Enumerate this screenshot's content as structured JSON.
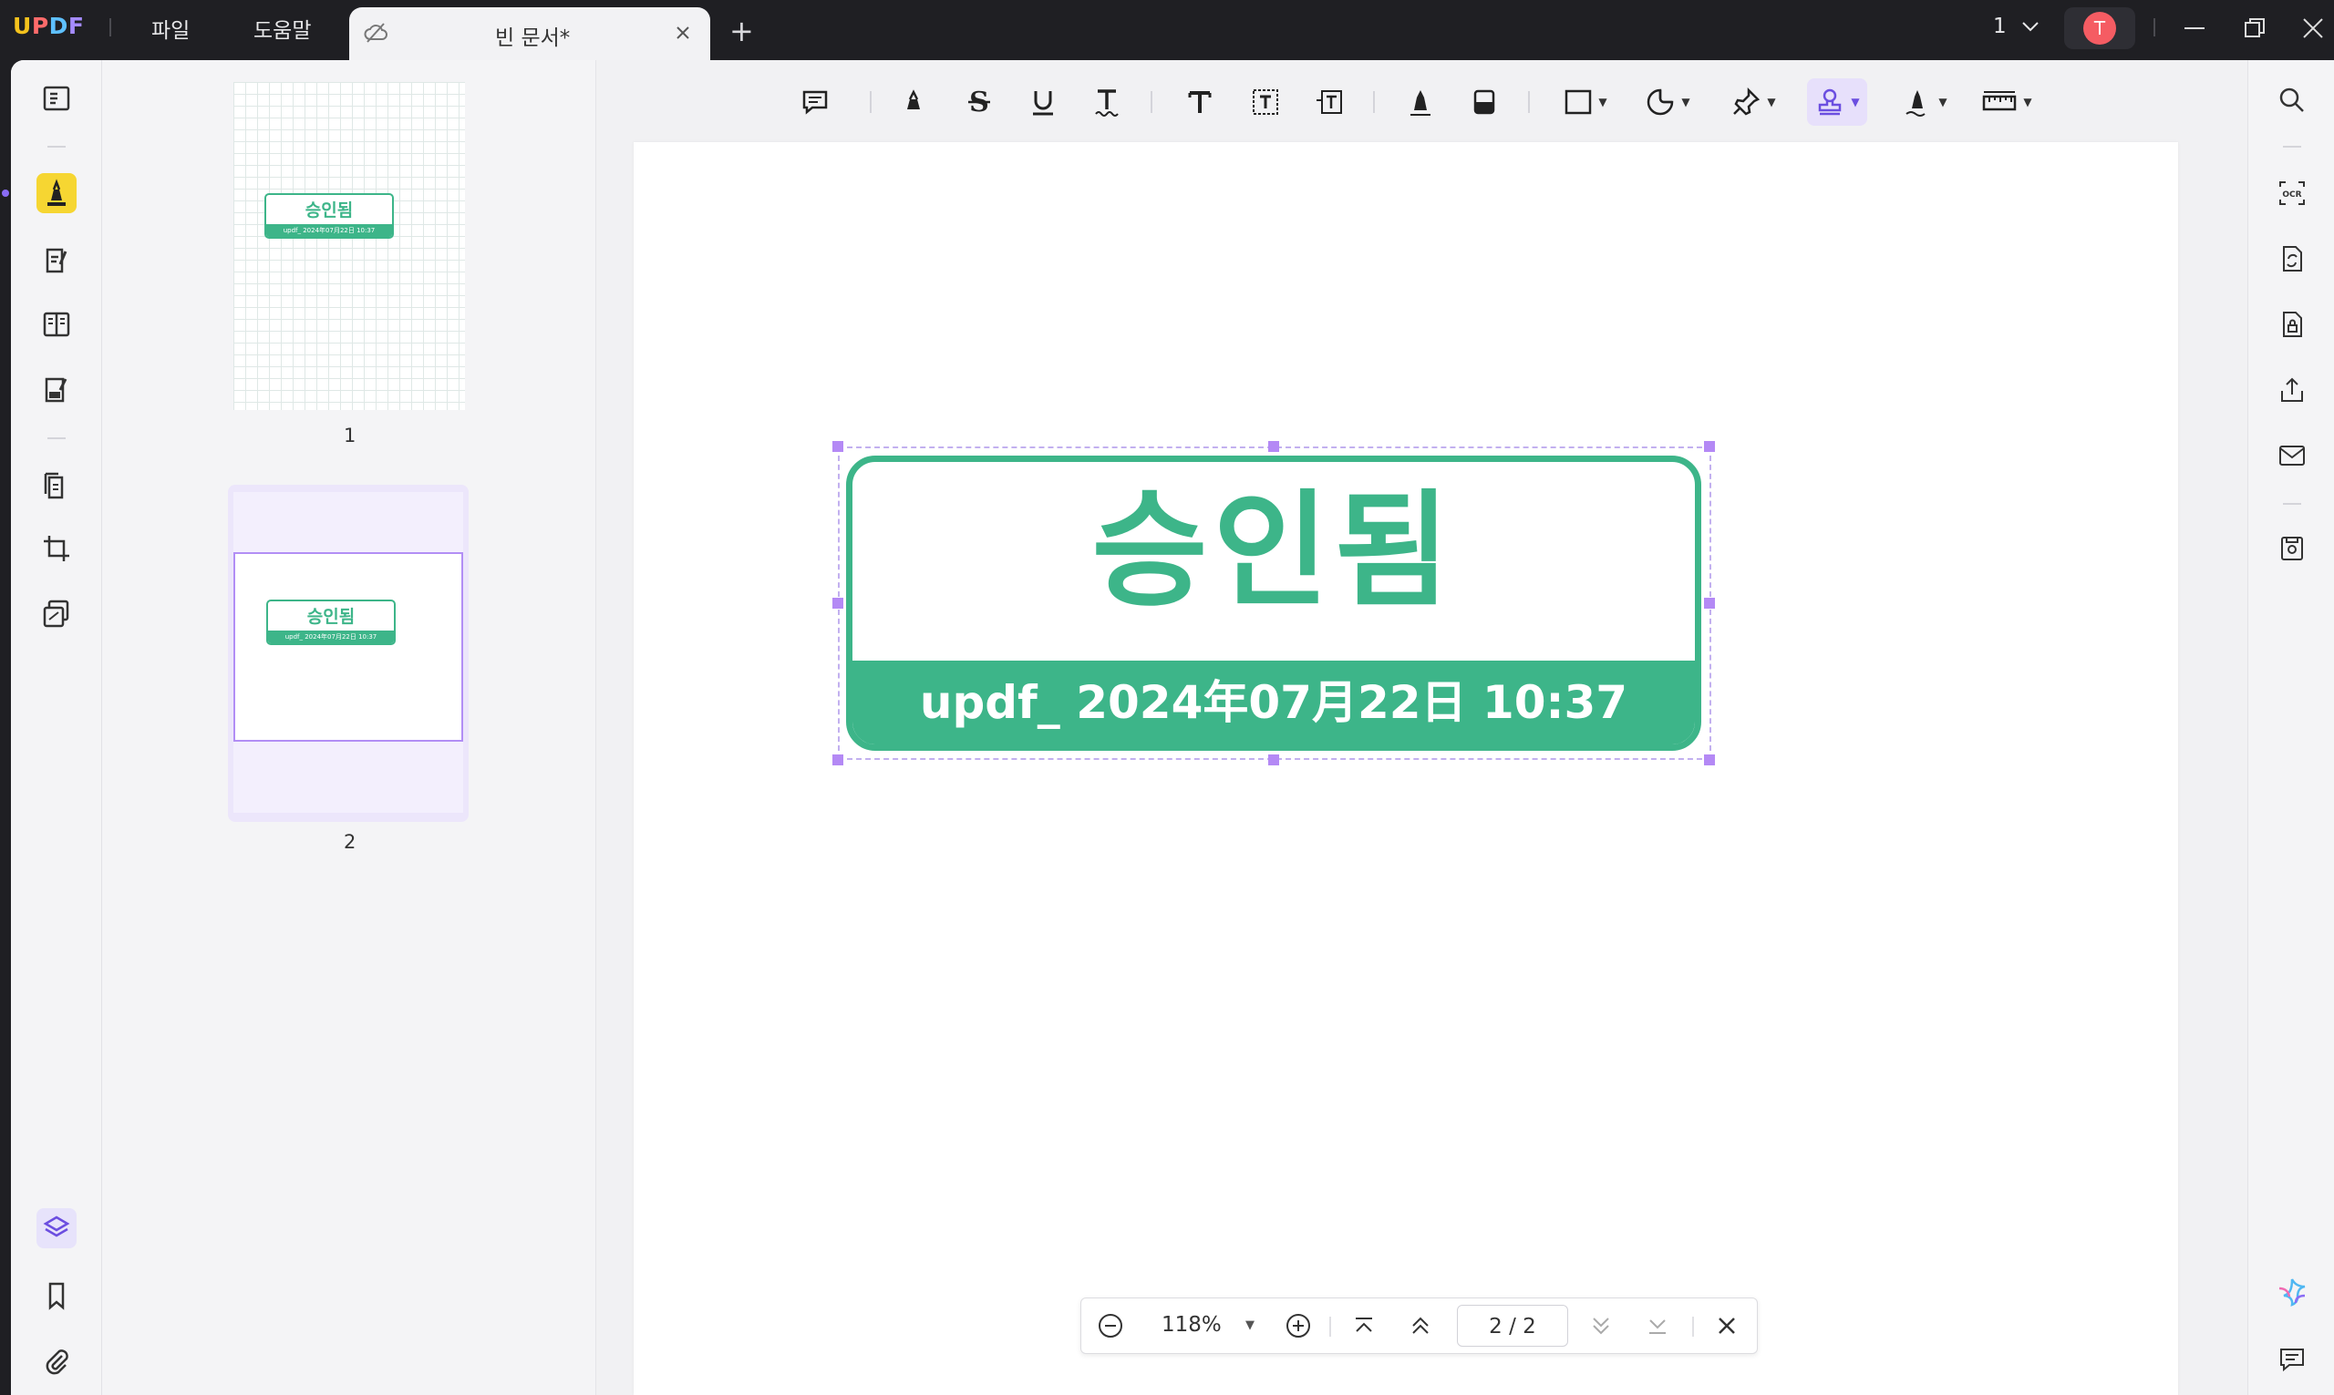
{
  "app": {
    "logo_u": "U",
    "logo_p": "P",
    "logo_d": "D",
    "logo_f": "F",
    "menu": {
      "file": "파일",
      "help": "도움말"
    },
    "tab": {
      "title": "빈 문서*"
    },
    "page_select": "1",
    "avatar_initial": "T"
  },
  "thumbnails": [
    {
      "label": "1",
      "stamp_title": "승인됨",
      "stamp_sub": "updf_ 2024年07月22日 10:37"
    },
    {
      "label": "2",
      "stamp_title": "승인됨",
      "stamp_sub": "updf_ 2024年07月22日 10:37"
    }
  ],
  "stamp": {
    "title": "승인됨",
    "subtitle": "updf_ 2024年07月22日 10:37",
    "color": "#3db589"
  },
  "navbar": {
    "zoom": "118%",
    "page_indicator": "2 / 2"
  },
  "colors": {
    "accent": "#8a6cf5",
    "highlight_active": "#f6d632",
    "stamp_green": "#3db589",
    "titlebar": "#1f1f23"
  }
}
